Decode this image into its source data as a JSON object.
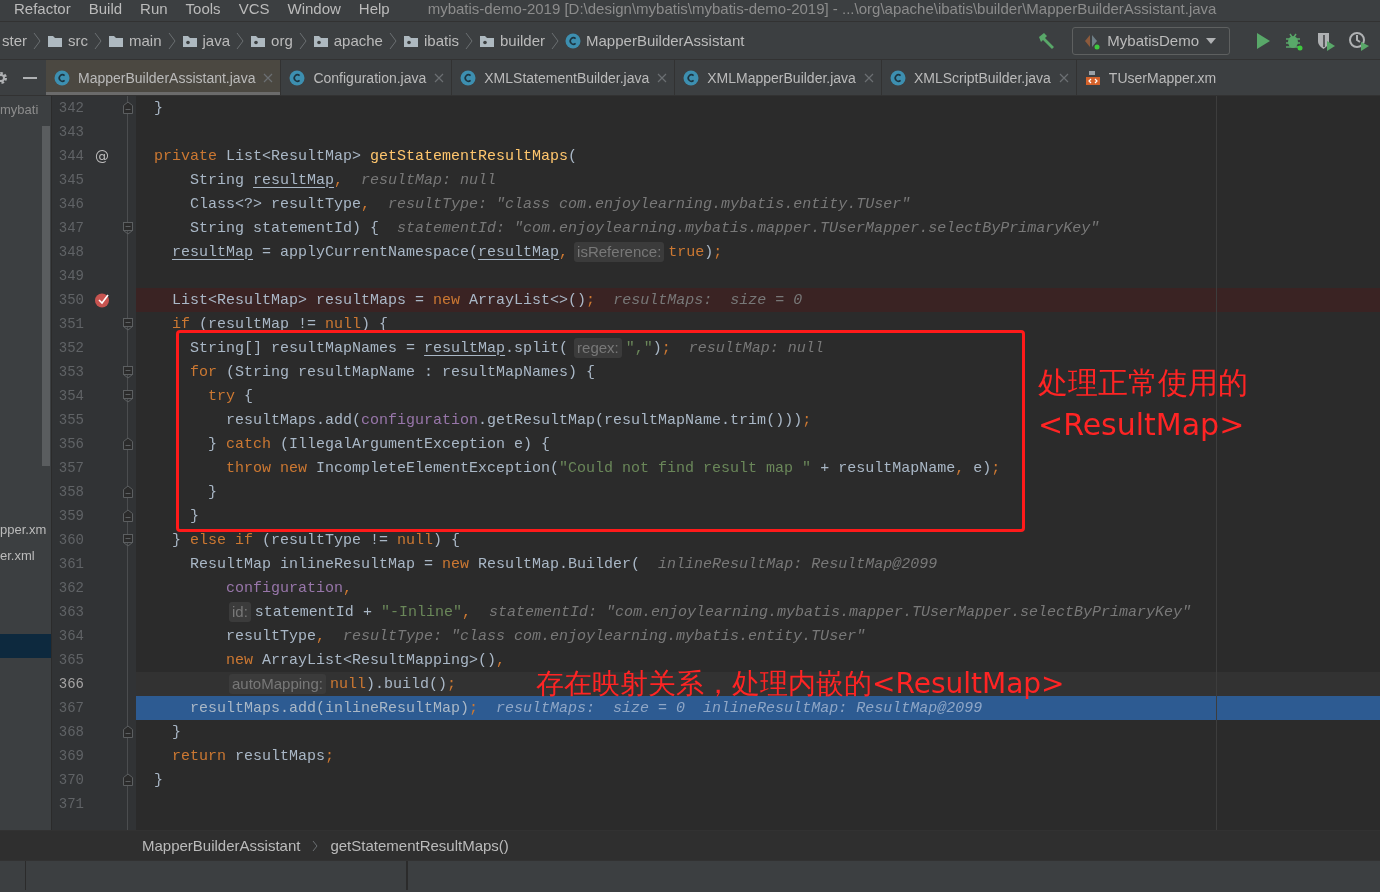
{
  "menu_bar": {
    "items": [
      {
        "label": "Refactor"
      },
      {
        "label": "Build"
      },
      {
        "label": "Run"
      },
      {
        "label": "Tools"
      },
      {
        "label": "VCS"
      },
      {
        "label": "Window"
      },
      {
        "label": "Help"
      }
    ],
    "title": "mybatis-demo-2019 [D:\\design\\mybatis\\mybatis-demo-2019] - ...\\org\\apache\\ibatis\\builder\\MapperBuilderAssistant.java"
  },
  "navigation_bar": {
    "breadcrumbs": [
      {
        "label": "ster",
        "kind": "none"
      },
      {
        "label": "src",
        "kind": "folder"
      },
      {
        "label": "main",
        "kind": "folder"
      },
      {
        "label": "java",
        "kind": "package"
      },
      {
        "label": "org",
        "kind": "package"
      },
      {
        "label": "apache",
        "kind": "package"
      },
      {
        "label": "ibatis",
        "kind": "package"
      },
      {
        "label": "builder",
        "kind": "package"
      },
      {
        "label": "MapperBuilderAssistant",
        "kind": "class"
      }
    ],
    "run_configuration": "MybatisDemo"
  },
  "tabs": [
    {
      "label": "MapperBuilderAssistant.java",
      "kind": "class",
      "selected": true,
      "closable": true
    },
    {
      "label": "Configuration.java",
      "kind": "class",
      "selected": false,
      "closable": true
    },
    {
      "label": "XMLStatementBuilder.java",
      "kind": "class",
      "selected": false,
      "closable": true
    },
    {
      "label": "XMLMapperBuilder.java",
      "kind": "class",
      "selected": false,
      "closable": true
    },
    {
      "label": "XMLScriptBuilder.java",
      "kind": "class",
      "selected": false,
      "closable": true
    },
    {
      "label": "TUserMapper.xm",
      "kind": "xml",
      "selected": false,
      "closable": false
    }
  ],
  "project_panel": {
    "items": [
      {
        "label": "mybati",
        "selected": false
      },
      {
        "label": "pper.xm",
        "selected": false
      },
      {
        "label": "er.xml",
        "selected": false
      },
      {
        "selected": true
      }
    ]
  },
  "editor": {
    "lines": [
      {
        "number": "342",
        "fold_end": true,
        "tokens": [
          {
            "kind": "plain",
            "text": "  }"
          }
        ]
      },
      {
        "number": "343"
      },
      {
        "number": "344",
        "marker": "@",
        "tokens": [
          {
            "kind": "kw",
            "text": "  private "
          },
          {
            "kind": "plain",
            "text": "List<ResultMap> "
          },
          {
            "kind": "fn",
            "text": "getStatementResultMaps"
          },
          {
            "kind": "plain",
            "text": "("
          }
        ]
      },
      {
        "number": "345",
        "tokens": [
          {
            "kind": "plain",
            "text": "      String "
          },
          {
            "kind": "var",
            "text": "resultMap"
          },
          {
            "kind": "kw",
            "text": ","
          },
          {
            "kind": "hint",
            "text": "resultMap: null"
          }
        ]
      },
      {
        "number": "346",
        "tokens": [
          {
            "kind": "plain",
            "text": "      Class<?> resultType"
          },
          {
            "kind": "kw",
            "text": ","
          },
          {
            "kind": "hint",
            "text": "resultType: \"class com.enjoylearning.mybatis.entity.TUser\""
          }
        ]
      },
      {
        "number": "347",
        "fold_start": true,
        "tokens": [
          {
            "kind": "plain",
            "text": "      String statementId) {"
          },
          {
            "kind": "hint",
            "text": "statementId: \"com.enjoylearning.mybatis.mapper.TUserMapper.selectByPrimaryKey\""
          }
        ]
      },
      {
        "number": "348",
        "tokens": [
          {
            "kind": "var",
            "text": "    resultMap"
          },
          {
            "kind": "plain",
            "text": " = applyCurrentNamespace("
          },
          {
            "kind": "var",
            "text": "resultMap"
          },
          {
            "kind": "kw",
            "text": ","
          },
          {
            "kind": "inlay",
            "text": "isReference:"
          },
          {
            "kind": "kw",
            "text": "true"
          },
          {
            "kind": "plain",
            "text": ")"
          },
          {
            "kind": "kw",
            "text": ";"
          }
        ]
      },
      {
        "number": "349"
      },
      {
        "number": "350",
        "breakpoint": true,
        "tokens": [
          {
            "kind": "plain",
            "text": "    List<ResultMap> resultMaps = "
          },
          {
            "kind": "kw",
            "text": "new "
          },
          {
            "kind": "plain",
            "text": "ArrayList<>()"
          },
          {
            "kind": "kw",
            "text": ";"
          },
          {
            "kind": "hint",
            "text": "resultMaps:  size = 0"
          }
        ]
      },
      {
        "number": "351",
        "fold_start": true,
        "tokens": [
          {
            "kind": "kw",
            "text": "    if "
          },
          {
            "kind": "plain",
            "text": "("
          },
          {
            "kind": "var",
            "text": "resultMap"
          },
          {
            "kind": "plain",
            "text": " != "
          },
          {
            "kind": "kw",
            "text": "null"
          },
          {
            "kind": "plain",
            "text": ") {"
          }
        ]
      },
      {
        "number": "352",
        "tokens": [
          {
            "kind": "plain",
            "text": "      String[] resultMapNames = "
          },
          {
            "kind": "var",
            "text": "resultMap"
          },
          {
            "kind": "plain",
            "text": ".split("
          },
          {
            "kind": "inlay",
            "text": "regex:"
          },
          {
            "kind": "str",
            "text": "\",\""
          },
          {
            "kind": "plain",
            "text": ")"
          },
          {
            "kind": "kw",
            "text": ";"
          },
          {
            "kind": "hint",
            "text": "resultMap: null"
          }
        ]
      },
      {
        "number": "353",
        "fold_start": true,
        "tokens": [
          {
            "kind": "kw",
            "text": "      for "
          },
          {
            "kind": "plain",
            "text": "(String resultMapName : resultMapNames) {"
          }
        ]
      },
      {
        "number": "354",
        "fold_start": true,
        "tokens": [
          {
            "kind": "kw",
            "text": "        try "
          },
          {
            "kind": "plain",
            "text": "{"
          }
        ]
      },
      {
        "number": "355",
        "tokens": [
          {
            "kind": "plain",
            "text": "          resultMaps.add("
          },
          {
            "kind": "field",
            "text": "configuration"
          },
          {
            "kind": "plain",
            "text": ".getResultMap(resultMapName.trim()))"
          },
          {
            "kind": "kw",
            "text": ";"
          }
        ]
      },
      {
        "number": "356",
        "fold_end": true,
        "tokens": [
          {
            "kind": "plain",
            "text": "        } "
          },
          {
            "kind": "kw",
            "text": "catch "
          },
          {
            "kind": "plain",
            "text": "(IllegalArgumentException e) {"
          }
        ]
      },
      {
        "number": "357",
        "tokens": [
          {
            "kind": "kw",
            "text": "          throw new "
          },
          {
            "kind": "plain",
            "text": "IncompleteElementException("
          },
          {
            "kind": "str",
            "text": "\"Could not find result map \""
          },
          {
            "kind": "plain",
            "text": " + resultMapName"
          },
          {
            "kind": "kw",
            "text": ", "
          },
          {
            "kind": "plain",
            "text": "e)"
          },
          {
            "kind": "kw",
            "text": ";"
          }
        ]
      },
      {
        "number": "358",
        "fold_end": true,
        "tokens": [
          {
            "kind": "plain",
            "text": "        }"
          }
        ]
      },
      {
        "number": "359",
        "fold_end": true,
        "tokens": [
          {
            "kind": "plain",
            "text": "      }"
          }
        ]
      },
      {
        "number": "360",
        "fold_start": true,
        "tokens": [
          {
            "kind": "plain",
            "text": "    } "
          },
          {
            "kind": "kw",
            "text": "else if "
          },
          {
            "kind": "plain",
            "text": "(resultType != "
          },
          {
            "kind": "kw",
            "text": "null"
          },
          {
            "kind": "plain",
            "text": ") {"
          }
        ]
      },
      {
        "number": "361",
        "tokens": [
          {
            "kind": "plain",
            "text": "      ResultMap inlineResultMap = "
          },
          {
            "kind": "kw",
            "text": "new "
          },
          {
            "kind": "plain",
            "text": "ResultMap.Builder("
          },
          {
            "kind": "hint",
            "text": "inlineResultMap: ResultMap@2099"
          }
        ]
      },
      {
        "number": "362",
        "tokens": [
          {
            "kind": "field",
            "text": "          configuration"
          },
          {
            "kind": "kw",
            "text": ","
          }
        ]
      },
      {
        "number": "363",
        "tokens": [
          {
            "kind": "inlay",
            "text": "          id:"
          },
          {
            "kind": "plain",
            "text": "statementId + "
          },
          {
            "kind": "str",
            "text": "\"-Inline\""
          },
          {
            "kind": "kw",
            "text": ","
          },
          {
            "kind": "hint",
            "text": "statementId: \"com.enjoylearning.mybatis.mapper.TUserMapper.selectByPrimaryKey\""
          }
        ]
      },
      {
        "number": "364",
        "tokens": [
          {
            "kind": "plain",
            "text": "          resultType"
          },
          {
            "kind": "kw",
            "text": ","
          },
          {
            "kind": "hint",
            "text": "resultType: \"class com.enjoylearning.mybatis.entity.TUser\""
          }
        ]
      },
      {
        "number": "365",
        "tokens": [
          {
            "kind": "kw",
            "text": "          new "
          },
          {
            "kind": "plain",
            "text": "ArrayList<ResultMapping>()"
          },
          {
            "kind": "kw",
            "text": ","
          }
        ]
      },
      {
        "number": "366",
        "caret": true,
        "tokens": [
          {
            "kind": "inlay",
            "text": "          autoMapping:"
          },
          {
            "kind": "kw",
            "text": "null"
          },
          {
            "kind": "plain",
            "text": ").build()"
          },
          {
            "kind": "kw",
            "text": ";"
          }
        ]
      },
      {
        "number": "367",
        "execution_point": true,
        "tokens": [
          {
            "kind": "plain",
            "text": "      resultMaps.add(inlineResultMap)"
          },
          {
            "kind": "kw",
            "text": ";"
          },
          {
            "kind": "hint",
            "text": "resultMaps:  size = 0"
          },
          {
            "kind": "hint",
            "text": "inlineResultMap: ResultMap@2099"
          }
        ]
      },
      {
        "number": "368",
        "fold_end": true,
        "tokens": [
          {
            "kind": "plain",
            "text": "    }"
          }
        ]
      },
      {
        "number": "369",
        "tokens": [
          {
            "kind": "kw",
            "text": "    return "
          },
          {
            "kind": "plain",
            "text": "resultMaps"
          },
          {
            "kind": "kw",
            "text": ";"
          }
        ]
      },
      {
        "number": "370",
        "fold_end": true,
        "tokens": [
          {
            "kind": "plain",
            "text": "  }"
          }
        ]
      },
      {
        "number": "371"
      }
    ],
    "breadcrumbs": [
      "MapperBuilderAssistant",
      "getStatementResultMaps()"
    ]
  },
  "annotations": [
    {
      "kind": "box"
    },
    {
      "kind": "note",
      "text": "处理正常使用的<ResultMap>"
    },
    {
      "kind": "note",
      "text": "存在映射关系，处理内嵌的<ResultMap>"
    }
  ]
}
